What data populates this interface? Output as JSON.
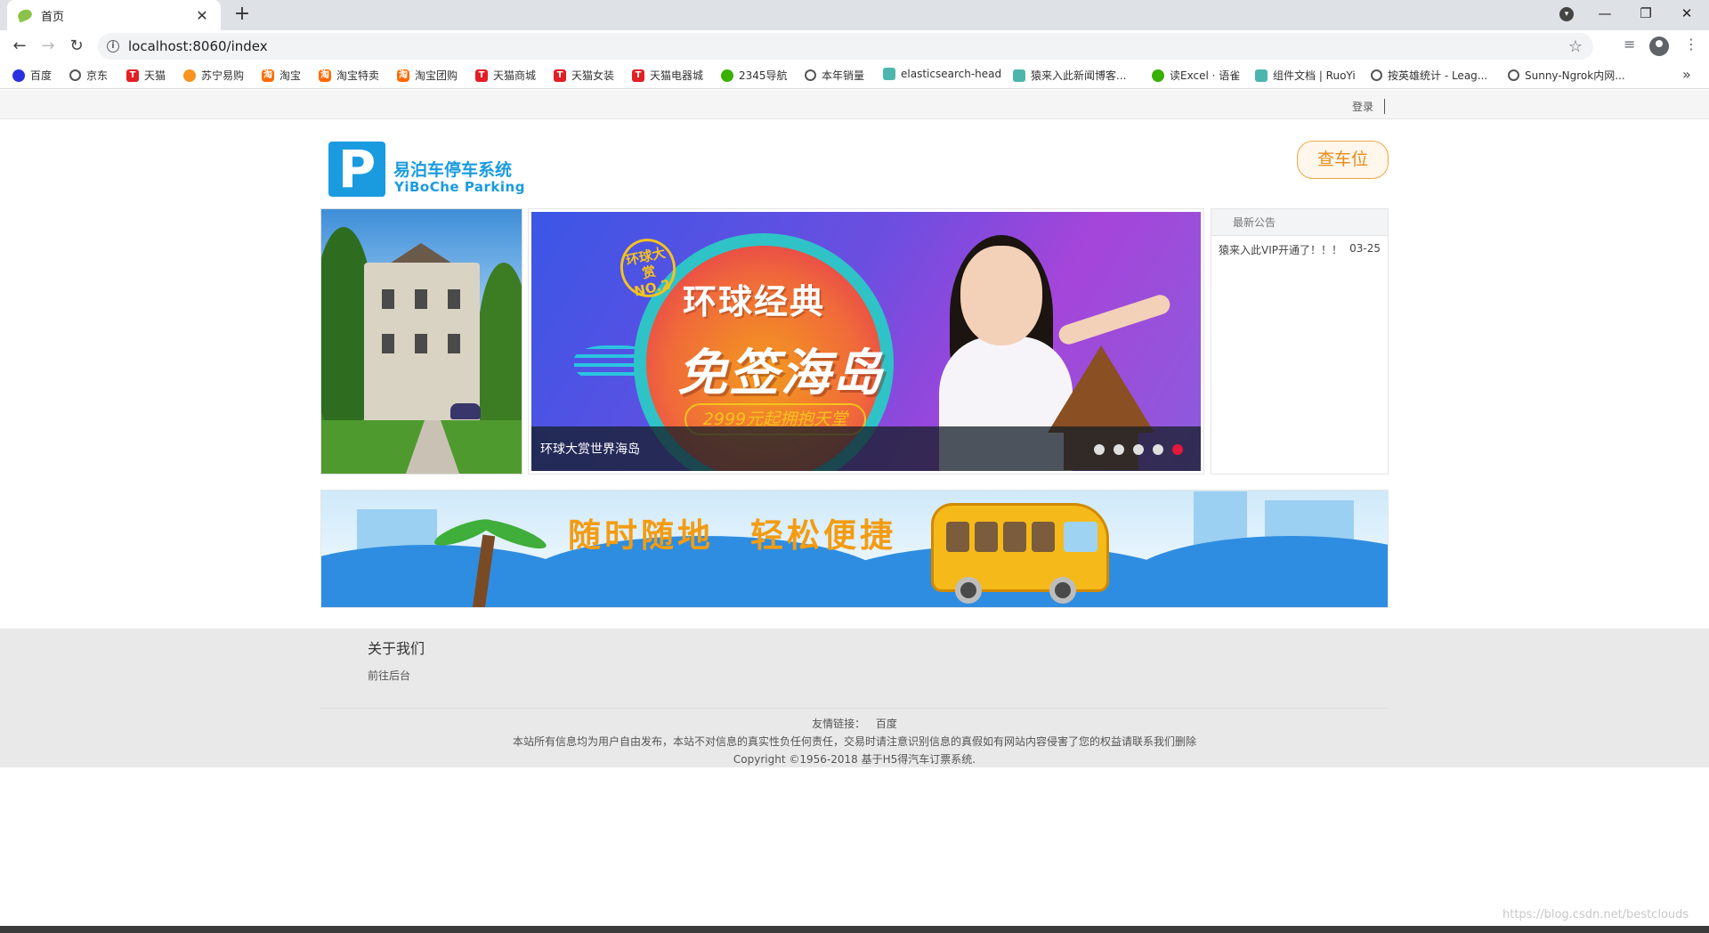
{
  "browser": {
    "tab_title": "首页",
    "url": "localhost:8060/index",
    "bookmarks": [
      {
        "label": "百度",
        "icon": "baidu-paw-icon"
      },
      {
        "label": "京东",
        "icon": "globe-icon"
      },
      {
        "label": "天猫",
        "icon": "tmall-icon"
      },
      {
        "label": "苏宁易购",
        "icon": "suning-icon"
      },
      {
        "label": "淘宝",
        "icon": "taobao-icon"
      },
      {
        "label": "淘宝特卖",
        "icon": "taobao-icon"
      },
      {
        "label": "淘宝团购",
        "icon": "taobao-icon"
      },
      {
        "label": "天猫商城",
        "icon": "tmall-icon"
      },
      {
        "label": "天猫女装",
        "icon": "tmall-icon"
      },
      {
        "label": "天猫电器城",
        "icon": "tmall-icon"
      },
      {
        "label": "2345导航",
        "icon": "nav-2345-icon"
      },
      {
        "label": "本年销量",
        "icon": "globe-icon"
      },
      {
        "label": "elasticsearch-head",
        "icon": "elasticsearch-icon"
      },
      {
        "label": "猿来入此新闻博客...",
        "icon": "blog-icon"
      },
      {
        "label": "读Excel · 语雀",
        "icon": "yuque-icon"
      },
      {
        "label": "组件文档 | RuoYi",
        "icon": "ruoyi-icon"
      },
      {
        "label": "按英雄统计 - Leag...",
        "icon": "globe-icon"
      },
      {
        "label": "Sunny-Ngrok内网...",
        "icon": "globe-icon"
      }
    ]
  },
  "header": {
    "login_label": "登录",
    "logo_cn": "易泊车停车系统",
    "logo_en": "YiBoChe  Parking",
    "search_button": "查车位"
  },
  "slider": {
    "stamp_text": "环球大赏 NO.2",
    "headline": "环球经典",
    "headline2": "免签海岛",
    "price_text": "2999元起拥抱天堂",
    "caption": "环球大赏世界海岛",
    "slide_count": 5,
    "active_slide": 5
  },
  "notice": {
    "title": "最新公告",
    "items": [
      {
        "text": "猿来入此VIP开通了！！！",
        "date": "03-25"
      }
    ]
  },
  "banner": {
    "slogan": "随时随地　轻松便捷"
  },
  "footer": {
    "about_title": "关于我们",
    "admin_link": "前往后台",
    "links_label": "友情链接：",
    "link_baidu": "百度",
    "disclaimer": "本站所有信息均为用户自由发布，本站不对信息的真实性负任何责任，交易时请注意识别信息的真假如有网站内容侵害了您的权益请联系我们删除",
    "copyright": "Copyright ©1956-2018 基于H5得汽车订票系统."
  },
  "watermark": "https://blog.csdn.net/bestclouds",
  "colors": {
    "brand_blue": "#1a9be0",
    "accent_orange": "#e88a18",
    "active_dot": "#e5173c"
  }
}
